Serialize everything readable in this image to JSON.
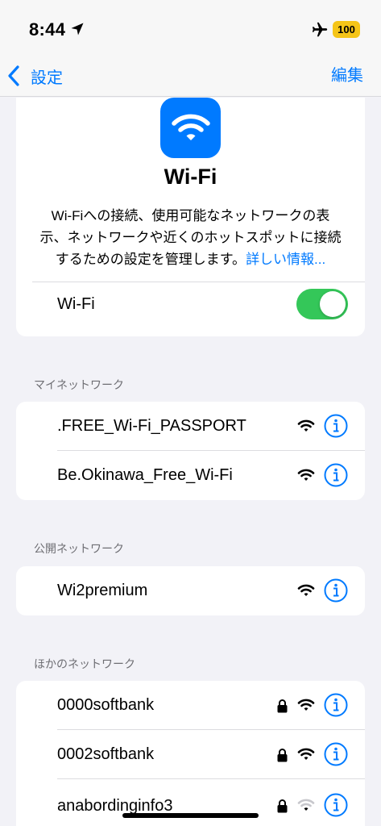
{
  "status_bar": {
    "time": "8:44",
    "battery": "100",
    "icons": [
      "location-arrow-icon",
      "airplane-icon"
    ]
  },
  "nav": {
    "back_label": "設定",
    "edit_label": "編集"
  },
  "hero": {
    "title": "Wi-Fi",
    "description": "Wi-Fiへの接続、使用可能なネットワークの表示、ネットワークや近くのホットスポットに接続するための設定を管理します。",
    "link": "詳しい情報..."
  },
  "wifi_toggle": {
    "label": "Wi-Fi",
    "on": true
  },
  "colors": {
    "accent": "#007aff",
    "toggle_on": "#34c759",
    "battery": "#f5c518",
    "background": "#f2f2f7"
  },
  "sections": {
    "my_networks": {
      "header": "マイネットワーク",
      "items": [
        {
          "name": ".FREE_Wi-Fi_PASSPORT",
          "locked": false,
          "signal": 3
        },
        {
          "name": "Be.Okinawa_Free_Wi-Fi",
          "locked": false,
          "signal": 3
        }
      ]
    },
    "public_networks": {
      "header": "公開ネットワーク",
      "items": [
        {
          "name": "Wi2premium",
          "locked": false,
          "signal": 3
        }
      ]
    },
    "other_networks": {
      "header": "ほかのネットワーク",
      "items": [
        {
          "name": "0000softbank",
          "locked": true,
          "signal": 3
        },
        {
          "name": "0002softbank",
          "locked": true,
          "signal": 3
        },
        {
          "name": "anabordinginfo3",
          "locked": true,
          "signal": 1
        }
      ]
    }
  }
}
